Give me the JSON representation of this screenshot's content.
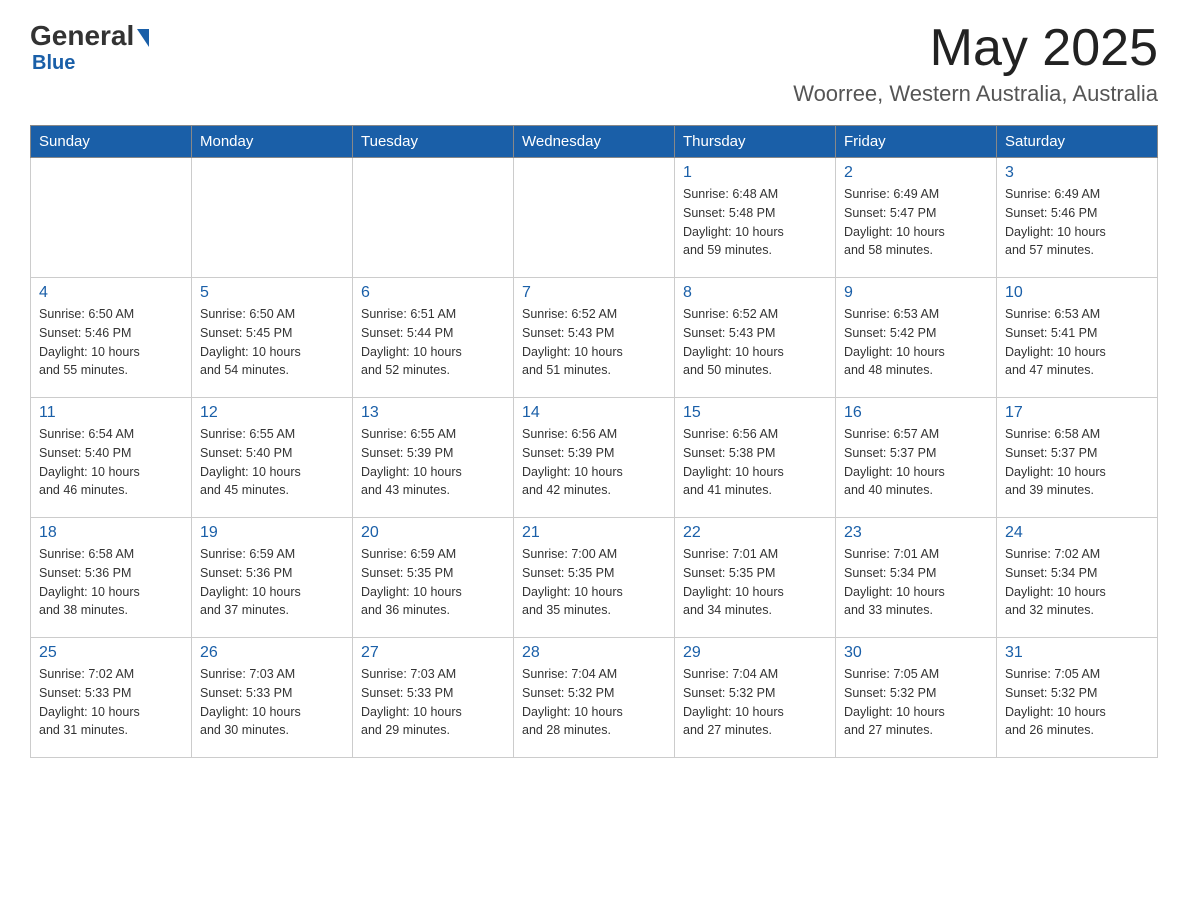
{
  "header": {
    "logo": {
      "general": "General",
      "blue": "Blue"
    },
    "title": "May 2025",
    "location": "Woorree, Western Australia, Australia"
  },
  "calendar": {
    "days_of_week": [
      "Sunday",
      "Monday",
      "Tuesday",
      "Wednesday",
      "Thursday",
      "Friday",
      "Saturday"
    ],
    "weeks": [
      [
        {
          "day": "",
          "info": ""
        },
        {
          "day": "",
          "info": ""
        },
        {
          "day": "",
          "info": ""
        },
        {
          "day": "",
          "info": ""
        },
        {
          "day": "1",
          "info": "Sunrise: 6:48 AM\nSunset: 5:48 PM\nDaylight: 10 hours\nand 59 minutes."
        },
        {
          "day": "2",
          "info": "Sunrise: 6:49 AM\nSunset: 5:47 PM\nDaylight: 10 hours\nand 58 minutes."
        },
        {
          "day": "3",
          "info": "Sunrise: 6:49 AM\nSunset: 5:46 PM\nDaylight: 10 hours\nand 57 minutes."
        }
      ],
      [
        {
          "day": "4",
          "info": "Sunrise: 6:50 AM\nSunset: 5:46 PM\nDaylight: 10 hours\nand 55 minutes."
        },
        {
          "day": "5",
          "info": "Sunrise: 6:50 AM\nSunset: 5:45 PM\nDaylight: 10 hours\nand 54 minutes."
        },
        {
          "day": "6",
          "info": "Sunrise: 6:51 AM\nSunset: 5:44 PM\nDaylight: 10 hours\nand 52 minutes."
        },
        {
          "day": "7",
          "info": "Sunrise: 6:52 AM\nSunset: 5:43 PM\nDaylight: 10 hours\nand 51 minutes."
        },
        {
          "day": "8",
          "info": "Sunrise: 6:52 AM\nSunset: 5:43 PM\nDaylight: 10 hours\nand 50 minutes."
        },
        {
          "day": "9",
          "info": "Sunrise: 6:53 AM\nSunset: 5:42 PM\nDaylight: 10 hours\nand 48 minutes."
        },
        {
          "day": "10",
          "info": "Sunrise: 6:53 AM\nSunset: 5:41 PM\nDaylight: 10 hours\nand 47 minutes."
        }
      ],
      [
        {
          "day": "11",
          "info": "Sunrise: 6:54 AM\nSunset: 5:40 PM\nDaylight: 10 hours\nand 46 minutes."
        },
        {
          "day": "12",
          "info": "Sunrise: 6:55 AM\nSunset: 5:40 PM\nDaylight: 10 hours\nand 45 minutes."
        },
        {
          "day": "13",
          "info": "Sunrise: 6:55 AM\nSunset: 5:39 PM\nDaylight: 10 hours\nand 43 minutes."
        },
        {
          "day": "14",
          "info": "Sunrise: 6:56 AM\nSunset: 5:39 PM\nDaylight: 10 hours\nand 42 minutes."
        },
        {
          "day": "15",
          "info": "Sunrise: 6:56 AM\nSunset: 5:38 PM\nDaylight: 10 hours\nand 41 minutes."
        },
        {
          "day": "16",
          "info": "Sunrise: 6:57 AM\nSunset: 5:37 PM\nDaylight: 10 hours\nand 40 minutes."
        },
        {
          "day": "17",
          "info": "Sunrise: 6:58 AM\nSunset: 5:37 PM\nDaylight: 10 hours\nand 39 minutes."
        }
      ],
      [
        {
          "day": "18",
          "info": "Sunrise: 6:58 AM\nSunset: 5:36 PM\nDaylight: 10 hours\nand 38 minutes."
        },
        {
          "day": "19",
          "info": "Sunrise: 6:59 AM\nSunset: 5:36 PM\nDaylight: 10 hours\nand 37 minutes."
        },
        {
          "day": "20",
          "info": "Sunrise: 6:59 AM\nSunset: 5:35 PM\nDaylight: 10 hours\nand 36 minutes."
        },
        {
          "day": "21",
          "info": "Sunrise: 7:00 AM\nSunset: 5:35 PM\nDaylight: 10 hours\nand 35 minutes."
        },
        {
          "day": "22",
          "info": "Sunrise: 7:01 AM\nSunset: 5:35 PM\nDaylight: 10 hours\nand 34 minutes."
        },
        {
          "day": "23",
          "info": "Sunrise: 7:01 AM\nSunset: 5:34 PM\nDaylight: 10 hours\nand 33 minutes."
        },
        {
          "day": "24",
          "info": "Sunrise: 7:02 AM\nSunset: 5:34 PM\nDaylight: 10 hours\nand 32 minutes."
        }
      ],
      [
        {
          "day": "25",
          "info": "Sunrise: 7:02 AM\nSunset: 5:33 PM\nDaylight: 10 hours\nand 31 minutes."
        },
        {
          "day": "26",
          "info": "Sunrise: 7:03 AM\nSunset: 5:33 PM\nDaylight: 10 hours\nand 30 minutes."
        },
        {
          "day": "27",
          "info": "Sunrise: 7:03 AM\nSunset: 5:33 PM\nDaylight: 10 hours\nand 29 minutes."
        },
        {
          "day": "28",
          "info": "Sunrise: 7:04 AM\nSunset: 5:32 PM\nDaylight: 10 hours\nand 28 minutes."
        },
        {
          "day": "29",
          "info": "Sunrise: 7:04 AM\nSunset: 5:32 PM\nDaylight: 10 hours\nand 27 minutes."
        },
        {
          "day": "30",
          "info": "Sunrise: 7:05 AM\nSunset: 5:32 PM\nDaylight: 10 hours\nand 27 minutes."
        },
        {
          "day": "31",
          "info": "Sunrise: 7:05 AM\nSunset: 5:32 PM\nDaylight: 10 hours\nand 26 minutes."
        }
      ]
    ]
  }
}
